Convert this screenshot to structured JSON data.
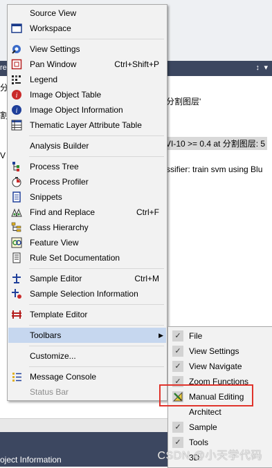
{
  "background": {
    "darkbar_left": "re",
    "pin_glyph": "↕",
    "dropdown_glyph": "▾",
    "line1": "分割图层'",
    "line2": "VI-10 >= 0.4  at  分割图层: 5",
    "line3": "ssifier: train svm using Blu",
    "left_fragments": [
      "分",
      "割",
      "V"
    ],
    "bottom_tab": "oject Information"
  },
  "main_menu": {
    "items": [
      {
        "icon": "none",
        "label": "Source View",
        "shortcut": ""
      },
      {
        "icon": "workspace-icon",
        "label": "Workspace",
        "shortcut": ""
      },
      {
        "icon": "view-settings-icon",
        "label": "View Settings",
        "shortcut": ""
      },
      {
        "icon": "pan-window-icon",
        "label": "Pan Window",
        "shortcut": "Ctrl+Shift+P"
      },
      {
        "icon": "legend-icon",
        "label": "Legend",
        "shortcut": ""
      },
      {
        "icon": "image-object-table-icon",
        "label": "Image Object Table",
        "shortcut": ""
      },
      {
        "icon": "image-object-info-icon",
        "label": "Image Object Information",
        "shortcut": ""
      },
      {
        "icon": "thematic-table-icon",
        "label": "Thematic Layer Attribute Table",
        "shortcut": ""
      },
      {
        "icon": "analysis-builder-icon",
        "label": "Analysis Builder",
        "shortcut": ""
      },
      {
        "icon": "process-tree-icon",
        "label": "Process Tree",
        "shortcut": ""
      },
      {
        "icon": "process-profiler-icon",
        "label": "Process Profiler",
        "shortcut": ""
      },
      {
        "icon": "snippets-icon",
        "label": "Snippets",
        "shortcut": ""
      },
      {
        "icon": "find-replace-icon",
        "label": "Find and Replace",
        "shortcut": "Ctrl+F"
      },
      {
        "icon": "class-hierarchy-icon",
        "label": "Class Hierarchy",
        "shortcut": ""
      },
      {
        "icon": "feature-view-icon",
        "label": "Feature View",
        "shortcut": ""
      },
      {
        "icon": "ruleset-doc-icon",
        "label": "Rule Set Documentation",
        "shortcut": ""
      },
      {
        "icon": "sample-editor-icon",
        "label": "Sample Editor",
        "shortcut": "Ctrl+M"
      },
      {
        "icon": "sample-selection-icon",
        "label": "Sample Selection Information",
        "shortcut": ""
      },
      {
        "icon": "template-editor-icon",
        "label": "Template Editor",
        "shortcut": ""
      },
      {
        "icon": "none",
        "label": "Toolbars",
        "shortcut": "",
        "submenu": true
      },
      {
        "icon": "none",
        "label": "Customize...",
        "shortcut": ""
      },
      {
        "icon": "message-console-icon",
        "label": "Message Console",
        "shortcut": ""
      },
      {
        "icon": "none",
        "label": "Status Bar",
        "shortcut": "",
        "disabled": true
      }
    ]
  },
  "toolbars_submenu": {
    "items": [
      {
        "label": "File",
        "checked": true
      },
      {
        "label": "View Settings",
        "checked": true
      },
      {
        "label": "View Navigate",
        "checked": true
      },
      {
        "label": "Zoom Functions",
        "checked": true
      },
      {
        "label": "Manual Editing",
        "checked": false,
        "icon": "manual-editing-icon",
        "highlighted": true
      },
      {
        "label": "Architect",
        "checked": false
      },
      {
        "label": "Sample",
        "checked": true
      },
      {
        "label": "Tools",
        "checked": true
      },
      {
        "label": "3D",
        "checked": false
      }
    ]
  },
  "watermark": "CSDN @小天学代码",
  "colors": {
    "menu_bg": "#f2f2f2",
    "active_item": "#c6d7ef",
    "highlight_border": "#e0332b",
    "dark_bar": "#3c4760"
  }
}
